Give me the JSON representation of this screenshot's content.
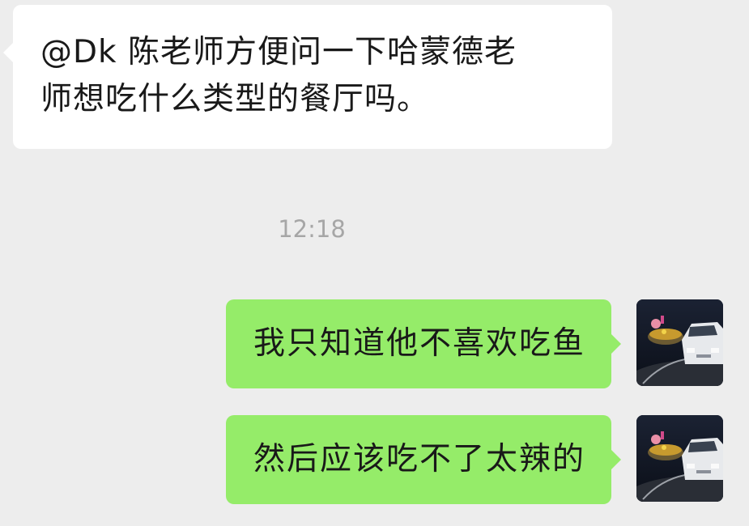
{
  "chat": {
    "messages": [
      {
        "direction": "incoming",
        "line1": "@Dk  陈老师方便问一下哈蒙德老",
        "line2": "师想吃什么类型的餐厅吗。"
      }
    ],
    "timestamp": "12:18",
    "outgoing": [
      {
        "text": "我只知道他不喜欢吃鱼"
      },
      {
        "text": "然后应该吃不了太辣的"
      }
    ]
  },
  "colors": {
    "background": "#ededed",
    "incoming_bubble": "#ffffff",
    "outgoing_bubble": "#95ec69",
    "timestamp": "#a6a6a6"
  },
  "avatar": {
    "icon": "avatar-icon"
  }
}
